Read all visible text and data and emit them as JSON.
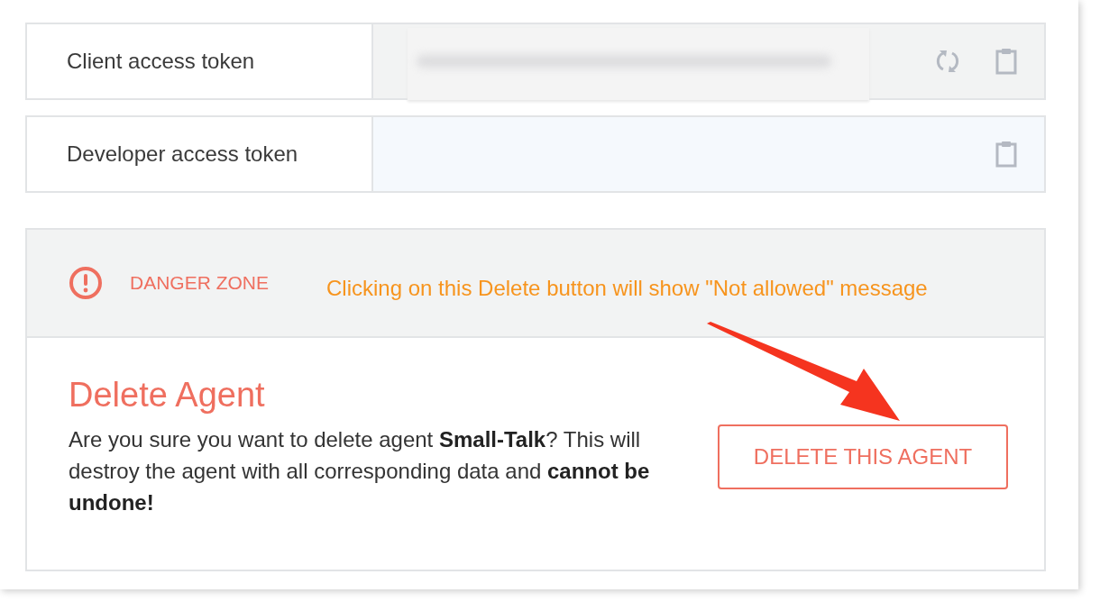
{
  "tokens": [
    {
      "label": "Client access token",
      "kind": "masked",
      "actions": [
        {
          "kind": "refresh"
        },
        {
          "kind": "copy"
        }
      ]
    },
    {
      "label": "Developer access token",
      "kind": "empty",
      "actions": [
        {
          "kind": "copy"
        }
      ]
    }
  ],
  "danger_zone": {
    "title": "DANGER ZONE",
    "annotation": "Clicking on this Delete button will show \"Not allowed\" message",
    "heading": "Delete Agent",
    "description": "Are you sure you want to delete agent **Small-Talk**? This will destroy the agent with all corresponding data and **cannot be undone!**",
    "button": "DELETE THIS AGENT"
  }
}
